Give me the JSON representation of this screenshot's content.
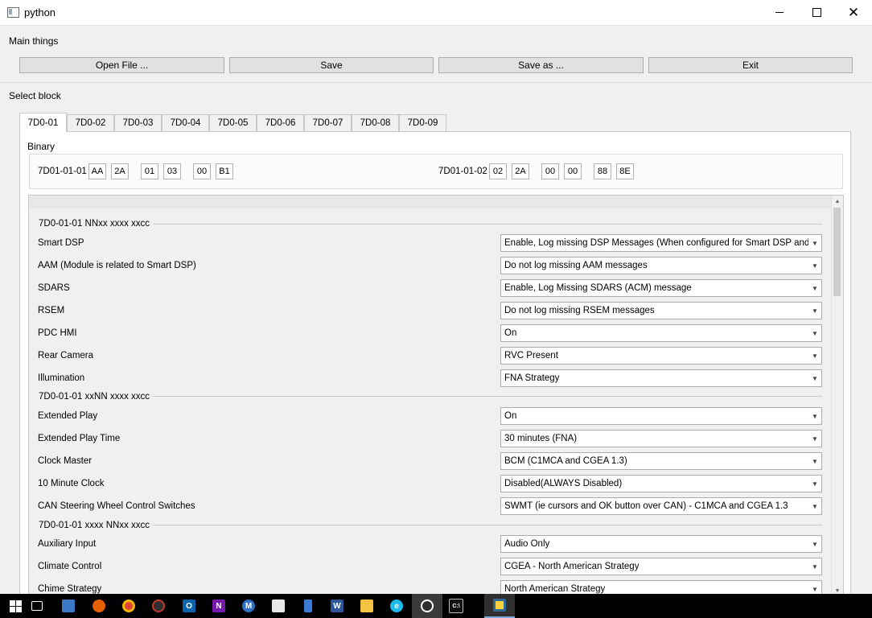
{
  "window": {
    "title": "python"
  },
  "main_group": {
    "label": "Main things",
    "buttons": [
      "Open File ...",
      "Save",
      "Save as ...",
      "Exit"
    ]
  },
  "select_block": {
    "label": "Select block",
    "tabs": [
      "7D0-01",
      "7D0-02",
      "7D0-03",
      "7D0-04",
      "7D0-05",
      "7D0-06",
      "7D0-07",
      "7D0-08",
      "7D0-09"
    ],
    "active_tab": "7D0-01"
  },
  "binary": {
    "label": "Binary",
    "groups": [
      {
        "name": "7D01-01-01",
        "values": [
          "AA",
          "2A",
          "01",
          "03",
          "00",
          "B1"
        ]
      },
      {
        "name": "7D01-01-02",
        "values": [
          "02",
          "2A",
          "00",
          "00",
          "88",
          "8E"
        ]
      }
    ]
  },
  "sections": [
    {
      "title": "7D0-01-01 NNxx xxxx xxcc",
      "rows": [
        {
          "label": "Smart DSP",
          "value": "Enable, Log missing DSP Messages (When configured for Smart DSP and Lincol"
        },
        {
          "label": "AAM (Module is related to Smart DSP)",
          "value": "Do not log missing AAM messages"
        },
        {
          "label": "SDARS",
          "value": "Enable, Log Missing SDARS (ACM) message"
        },
        {
          "label": "RSEM",
          "value": "Do not log missing RSEM messages"
        },
        {
          "label": "PDC HMI",
          "value": "On"
        },
        {
          "label": "Rear Camera",
          "value": "RVC Present"
        },
        {
          "label": "Illumination",
          "value": "FNA Strategy"
        }
      ]
    },
    {
      "title": "7D0-01-01 xxNN xxxx xxcc",
      "rows": [
        {
          "label": "Extended Play",
          "value": "On"
        },
        {
          "label": "Extended Play Time",
          "value": "30 minutes (FNA)"
        },
        {
          "label": "Clock Master",
          "value": "BCM (C1MCA and CGEA 1.3)"
        },
        {
          "label": "10 Minute Clock",
          "value": "Disabled(ALWAYS Disabled)"
        },
        {
          "label": "CAN Steering Wheel Control Switches",
          "value": "SWMT (ie cursors and OK button over CAN) - C1MCA and CGEA 1.3"
        }
      ]
    },
    {
      "title": "7D0-01-01 xxxx NNxx xxcc",
      "rows": [
        {
          "label": "Auxiliary Input",
          "value": "Audio Only"
        },
        {
          "label": "Climate Control",
          "value": "CGEA - North American Strategy"
        },
        {
          "label": "Chime Strategy",
          "value": "North American Strategy"
        }
      ]
    }
  ],
  "taskbar": {
    "items": [
      "windows-start",
      "task-view",
      "desktop-app",
      "firefox",
      "chrome",
      "obs",
      "outlook",
      "onenote",
      "m-app",
      "python-idle",
      "phone-app",
      "word",
      "file-explorer",
      "internet-explorer",
      "inkscape",
      "command-prompt",
      "python-window"
    ]
  },
  "colors": {
    "window_bg": "#f0f0f0",
    "pane_bg": "#ffffff",
    "taskbar_bg": "#000000",
    "button_bg": "#e1e1e1"
  }
}
